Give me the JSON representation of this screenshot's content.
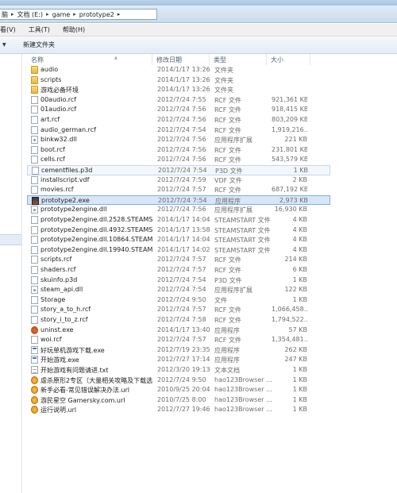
{
  "window": {
    "title": ""
  },
  "address": {
    "segments": [
      "脑",
      "文档 (E:)",
      "game",
      "prototype2"
    ]
  },
  "menu": {
    "items": [
      "看(V)",
      "工具(T)",
      "帮助(H)"
    ]
  },
  "toolbar": {
    "new_folder": "新建文件夹"
  },
  "columns": {
    "name": "名称",
    "date": "修改日期",
    "type": "类型",
    "size": "大小"
  },
  "files": [
    {
      "name": "audio",
      "date": "2014/1/17 13:26",
      "type": "文件夹",
      "size": "",
      "icon": "folder-icon"
    },
    {
      "name": "scripts",
      "date": "2014/1/17 13:26",
      "type": "文件夹",
      "size": "",
      "icon": "folder-icon"
    },
    {
      "name": "游戏必备环境",
      "date": "2014/1/17 13:26",
      "type": "文件夹",
      "size": "",
      "icon": "folder-icon"
    },
    {
      "name": "00audio.rcf",
      "date": "2012/7/24 7:55",
      "type": "RCF 文件",
      "size": "921,361 KB",
      "icon": "file-icon"
    },
    {
      "name": "01audio.rcf",
      "date": "2012/7/24 7:56",
      "type": "RCF 文件",
      "size": "918,415 KB",
      "icon": "file-icon"
    },
    {
      "name": "art.rcf",
      "date": "2012/7/24 7:56",
      "type": "RCF 文件",
      "size": "803,209 KB",
      "icon": "file-icon"
    },
    {
      "name": "audio_german.rcf",
      "date": "2012/7/24 7:54",
      "type": "RCF 文件",
      "size": "1,919,216...",
      "icon": "file-icon"
    },
    {
      "name": "binkw32.dll",
      "date": "2012/7/24 7:56",
      "type": "应用程序扩展",
      "size": "221 KB",
      "icon": "dll-icon"
    },
    {
      "name": "boot.rcf",
      "date": "2012/7/24 7:56",
      "type": "RCF 文件",
      "size": "231,801 KB",
      "icon": "file-icon"
    },
    {
      "name": "cells.rcf",
      "date": "2012/7/24 7:56",
      "type": "RCF 文件",
      "size": "543,579 KB",
      "icon": "file-icon"
    },
    {
      "name": "cementfiles.p3d",
      "date": "2012/7/24 7:54",
      "type": "P3D 文件",
      "size": "1 KB",
      "icon": "file-icon"
    },
    {
      "name": "installscript.vdf",
      "date": "2012/7/24 7:59",
      "type": "VDF 文件",
      "size": "2 KB",
      "icon": "file-icon"
    },
    {
      "name": "movies.rcf",
      "date": "2012/7/24 7:57",
      "type": "RCF 文件",
      "size": "687,192 KB",
      "icon": "file-icon"
    },
    {
      "name": "prototype2.exe",
      "date": "2012/7/24 7:54",
      "type": "应用程序",
      "size": "2,973 KB",
      "icon": "game-exe-icon"
    },
    {
      "name": "prototype2engine.dll",
      "date": "2012/7/24 7:56",
      "type": "应用程序扩展",
      "size": "16,930 KB",
      "icon": "dll-icon"
    },
    {
      "name": "prototype2engine.dll.2528.STEAMST...",
      "date": "2014/1/17 14:04",
      "type": "STEAMSTART 文件",
      "size": "4 KB",
      "icon": "file-icon"
    },
    {
      "name": "prototype2engine.dll.4932.STEAMST...",
      "date": "2014/1/17 13:58",
      "type": "STEAMSTART 文件",
      "size": "4 KB",
      "icon": "file-icon"
    },
    {
      "name": "prototype2engine.dll.10864.STEAMS...",
      "date": "2014/1/17 14:04",
      "type": "STEAMSTART 文件",
      "size": "4 KB",
      "icon": "file-icon"
    },
    {
      "name": "prototype2engine.dll.19940.STEAMST...",
      "date": "2014/1/17 14:02",
      "type": "STEAMSTART 文件",
      "size": "4 KB",
      "icon": "file-icon"
    },
    {
      "name": "scripts.rcf",
      "date": "2012/7/24 7:57",
      "type": "RCF 文件",
      "size": "214 KB",
      "icon": "file-icon"
    },
    {
      "name": "shaders.rcf",
      "date": "2012/7/24 7:57",
      "type": "RCF 文件",
      "size": "6 KB",
      "icon": "file-icon"
    },
    {
      "name": "skuinfo.p3d",
      "date": "2012/7/24 7:54",
      "type": "P3D 文件",
      "size": "1 KB",
      "icon": "file-icon"
    },
    {
      "name": "steam_api.dll",
      "date": "2012/7/24 7:54",
      "type": "应用程序扩展",
      "size": "122 KB",
      "icon": "dll-icon"
    },
    {
      "name": "Storage",
      "date": "2012/7/24 9:50",
      "type": "文件",
      "size": "1 KB",
      "icon": "file-icon"
    },
    {
      "name": "story_a_to_h.rcf",
      "date": "2012/7/24 7:57",
      "type": "RCF 文件",
      "size": "1,066,458...",
      "icon": "file-icon"
    },
    {
      "name": "story_i_to_z.rcf",
      "date": "2012/7/24 7:58",
      "type": "RCF 文件",
      "size": "1,794,522...",
      "icon": "file-icon"
    },
    {
      "name": "uninst.exe",
      "date": "2014/1/17 13:40",
      "type": "应用程序",
      "size": "57 KB",
      "icon": "uninstall-icon"
    },
    {
      "name": "woi.rcf",
      "date": "2012/7/24 7:57",
      "type": "RCF 文件",
      "size": "1,354,481...",
      "icon": "file-icon"
    },
    {
      "name": "好玩单机游戏下载.exe",
      "date": "2012/7/19 23:35",
      "type": "应用程序",
      "size": "262 KB",
      "icon": "app-icon"
    },
    {
      "name": "开始游戏.exe",
      "date": "2012/7/27 17:14",
      "type": "应用程序",
      "size": "247 KB",
      "icon": "app-icon"
    },
    {
      "name": "开始游戏有问题请进.txt",
      "date": "2012/3/20 19:13",
      "type": "文本文档",
      "size": "1 KB",
      "icon": "text-file-icon"
    },
    {
      "name": "虐杀原形2专区（大量相关攻略及下载选...",
      "date": "2012/7/24 9:50",
      "type": "hao123Browser ...",
      "size": "1 KB",
      "icon": "url-icon"
    },
    {
      "name": "新手必看-常见错误解决办法.url",
      "date": "2010/9/25 20:04",
      "type": "hao123Browser ...",
      "size": "1 KB",
      "icon": "url-icon"
    },
    {
      "name": "游民星空 Gamersky.com.url",
      "date": "2010/7/25 8:00",
      "type": "hao123Browser ...",
      "size": "1 KB",
      "icon": "url-icon"
    },
    {
      "name": "运行说明.url",
      "date": "2012/7/27 19:46",
      "type": "hao123Browser ...",
      "size": "1 KB",
      "icon": "url-icon"
    }
  ]
}
